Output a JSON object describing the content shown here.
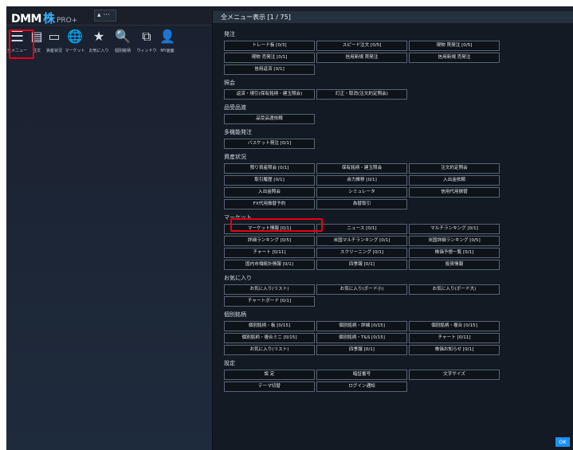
{
  "app": {
    "logo_main": "DMM",
    "logo_kabu": "株",
    "logo_sub": "PRO+",
    "bell_glyph": "▴ ···"
  },
  "toolbar": [
    {
      "key": "menu",
      "label": "全メニュー",
      "icon": "hamburger-icon",
      "glyph": "☰"
    },
    {
      "key": "order",
      "label": "注文",
      "icon": "order-icon",
      "glyph": "▤"
    },
    {
      "key": "assets",
      "label": "資産状況",
      "icon": "assets-icon",
      "glyph": "▭"
    },
    {
      "key": "market",
      "label": "マーケット",
      "icon": "globe-icon",
      "glyph": "🌐"
    },
    {
      "key": "favorite",
      "label": "お気に入り",
      "icon": "star-icon",
      "glyph": "★"
    },
    {
      "key": "issue",
      "label": "個別銘柄",
      "icon": "document-search-icon",
      "glyph": "🔍"
    },
    {
      "key": "window",
      "label": "ウィンドウ",
      "icon": "window-icon",
      "glyph": "⧉"
    },
    {
      "key": "my",
      "label": "MY画面",
      "icon": "user-add-icon",
      "glyph": "👤"
    }
  ],
  "panel": {
    "title": "全メニュー表示 [1 / 75]",
    "ok_label": "OK"
  },
  "sections": [
    {
      "title": "発注",
      "buttons": [
        "トレード板 [0/3]",
        "スピード注文 [0/5]",
        "現物 買発注 [0/5]",
        "現物 売発注 [0/1]",
        "信用新規 買発注",
        "信用新規 売発注",
        "信用返済 [0/1]"
      ]
    },
    {
      "title": "照会",
      "buttons": [
        "返済・現引(保有銘柄・建玉照会)",
        "訂正・取消(注文約定照会)"
      ]
    },
    {
      "title": "品受品渡",
      "buttons": [
        "品受品渡依頼"
      ]
    },
    {
      "title": "多機能発注",
      "buttons": [
        "バスケット発注 [0/1]"
      ]
    },
    {
      "title": "資産状況",
      "buttons": [
        "預り資産照会 [0/1]",
        "保有銘柄・建玉照会",
        "注文約定照会",
        "取引履歴 [0/1]",
        "余力推移 [0/1]",
        "入出金依頼",
        "入出金照会",
        "シミュレータ",
        "信用代用振替",
        "FX代用振替予約",
        "為替取引"
      ]
    },
    {
      "title": "マーケット",
      "buttons": [
        "マーケット情報 [0/1]",
        "ニュース [0/1]",
        "マルチランキング [0/1]",
        "詳細ランキング [0/5]",
        "米国マルチランキング [0/1]",
        "米国詳細ランキング [0/5]",
        "チャート [0/11]",
        "スクリーニング [0/1]",
        "株価予想一覧 [0/1]",
        "国内市場統計情報 [0/1]",
        "四季報 [0/1]",
        "投資情報"
      ]
    },
    {
      "title": "お気に入り",
      "buttons": [
        "お気に入り(リスト)",
        "お気に入り(ボード小)",
        "お気に入り(ボード大)",
        "チャートボード [0/1]"
      ]
    },
    {
      "title": "個別銘柄",
      "buttons": [
        "個別銘柄・板 [0/15]",
        "個別銘柄・詳細 [0/15]",
        "個別銘柄・複合 [0/15]",
        "個別銘柄・複合ミニ [0/15]",
        "個別銘柄・T&S [0/15]",
        "チャート [0/11]",
        "お気に入り(リスト)",
        "四季報 [0/1]",
        "株価お知らせ [0/1]"
      ]
    },
    {
      "title": "設定",
      "buttons": [
        "設 定",
        "暗証番号",
        "文字サイズ",
        "テーマ切替",
        "ログイン通知"
      ]
    }
  ],
  "highlight": {
    "color": "#e60012",
    "targets": [
      "全メニュー",
      "FX代用振替予約"
    ]
  }
}
